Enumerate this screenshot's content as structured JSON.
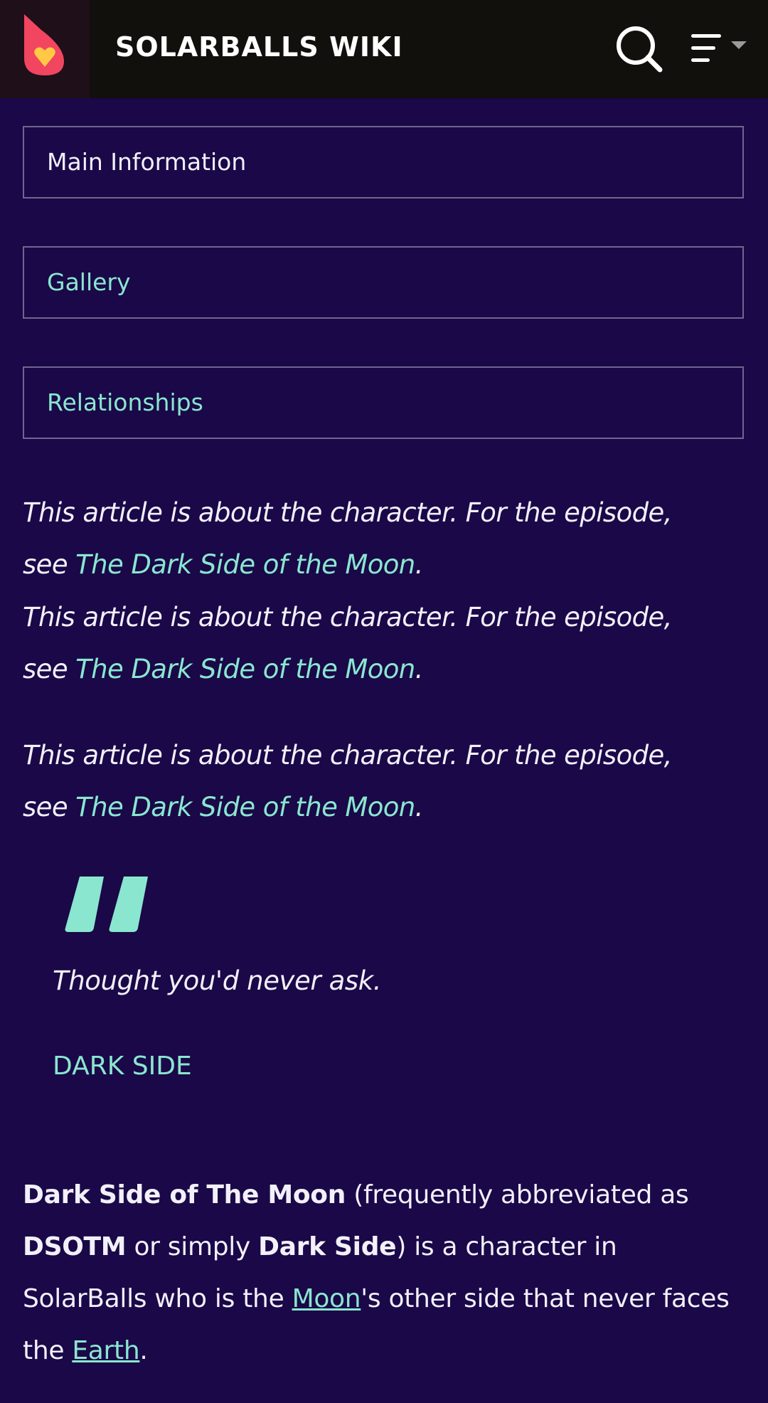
{
  "header": {
    "site_title": "SOLARBALLS WIKI",
    "logo_icon": "fandom-flame-heart-icon",
    "search_icon": "search-icon",
    "menu_icon": "menu-lines-dropdown-icon"
  },
  "tabs": [
    {
      "label": "Main Information"
    },
    {
      "label": "Gallery"
    },
    {
      "label": "Relationships"
    }
  ],
  "hatnotes": [
    {
      "line1": "This article is about the character. For the episode,",
      "prefix": "see ",
      "link": "The Dark Side of the Moon",
      "suffix": "."
    },
    {
      "line1": "This article is about the character. For the episode,",
      "prefix": "see ",
      "link": "The Dark Side of the Moon",
      "suffix": "."
    },
    {
      "line1": "This article is about the character. For the episode,",
      "prefix": "see ",
      "link": "The Dark Side of the Moon",
      "suffix": "."
    }
  ],
  "quote": {
    "icon": "quote-mark-icon",
    "text": "Thought you'd never ask.",
    "author": "DARK SIDE"
  },
  "intro": {
    "bold_name": "Dark Side of The Moon",
    "text1": " (frequently abbreviated as ",
    "bold_abbr": "DSOTM",
    "text2": " or simply ",
    "bold_short": "Dark Side",
    "text3": ") is a character in SolarBalls who is the ",
    "link_moon": "Moon",
    "text4": "'s other side that never faces the ",
    "link_earth": "Earth",
    "text5": "."
  },
  "colors": {
    "background": "#1a0848",
    "topbar": "#11100c",
    "link": "#8ae6cf",
    "text": "#f2f0f8",
    "logo_flame": "#f24560",
    "logo_heart": "#ffc945"
  }
}
